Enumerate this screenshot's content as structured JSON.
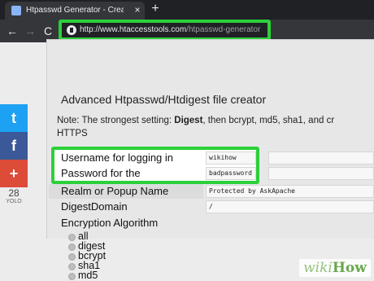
{
  "browser": {
    "tab_title": "Htpasswd Generator - Create Ht",
    "tab_close": "×",
    "new_tab": "+",
    "back": "←",
    "forward": "→",
    "reload": "C",
    "url_host": "http://www.htaccesstools.com",
    "url_path": "/htpasswd-generator"
  },
  "social": {
    "twitter": "t",
    "facebook": "f",
    "google": "+",
    "count": "28",
    "count_label": "YOLO"
  },
  "form": {
    "title": "Advanced Htpasswd/Htdigest file creator",
    "note_prefix": "Note: The strongest setting: ",
    "note_bold": "Digest",
    "note_suffix": ", then bcrypt, md5, sha1, and cr",
    "note_line2": "HTTPS",
    "username_label": "Username for logging in",
    "username_value": "wikihow",
    "password_label": "Password for the",
    "password_value": "badpassword",
    "realm_label": "Realm or Popup Name",
    "realm_value": "Protected by AskApache",
    "domain_label": "DigestDomain",
    "domain_value": "/",
    "algorithm_label": "Encryption Algorithm",
    "algorithms": [
      "all",
      "digest",
      "bcrypt",
      "sha1",
      "md5"
    ]
  },
  "watermark": {
    "wiki": "wiki",
    "how": "How"
  }
}
